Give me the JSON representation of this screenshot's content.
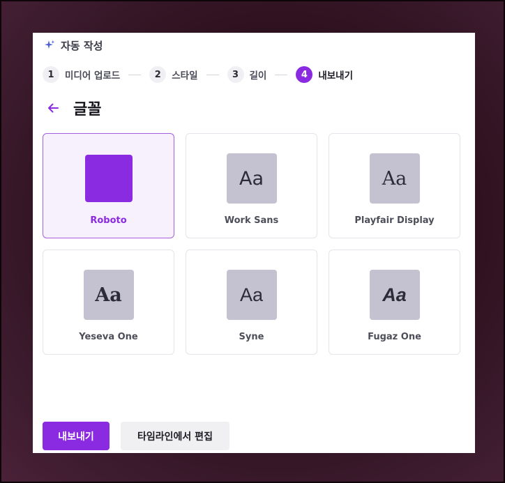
{
  "header": {
    "icon": "sparkle-icon",
    "title": "자동 작성"
  },
  "stepper": {
    "steps": [
      {
        "number": "1",
        "label": "미디어 업로드",
        "active": false
      },
      {
        "number": "2",
        "label": "스타일",
        "active": false
      },
      {
        "number": "3",
        "label": "길이",
        "active": false
      },
      {
        "number": "4",
        "label": "내보내기",
        "active": true
      }
    ]
  },
  "section": {
    "back_icon": "arrow-left-icon",
    "title": "글꼴"
  },
  "fonts": {
    "selected": "Roboto",
    "items": [
      {
        "name": "Roboto",
        "sample": ""
      },
      {
        "name": "Work Sans",
        "sample": "Aa"
      },
      {
        "name": "Playfair Display",
        "sample": "Aa"
      },
      {
        "name": "Yeseva One",
        "sample": "Aa"
      },
      {
        "name": "Syne",
        "sample": "Aa"
      },
      {
        "name": "Fugaz One",
        "sample": "Aa"
      }
    ]
  },
  "actions": {
    "export_label": "내보내기",
    "edit_timeline_label": "타임라인에서 편집"
  },
  "colors": {
    "accent": "#8a2be2",
    "selected_bg": "#f7f0fd",
    "swatch_bg": "#c4c2d0"
  }
}
